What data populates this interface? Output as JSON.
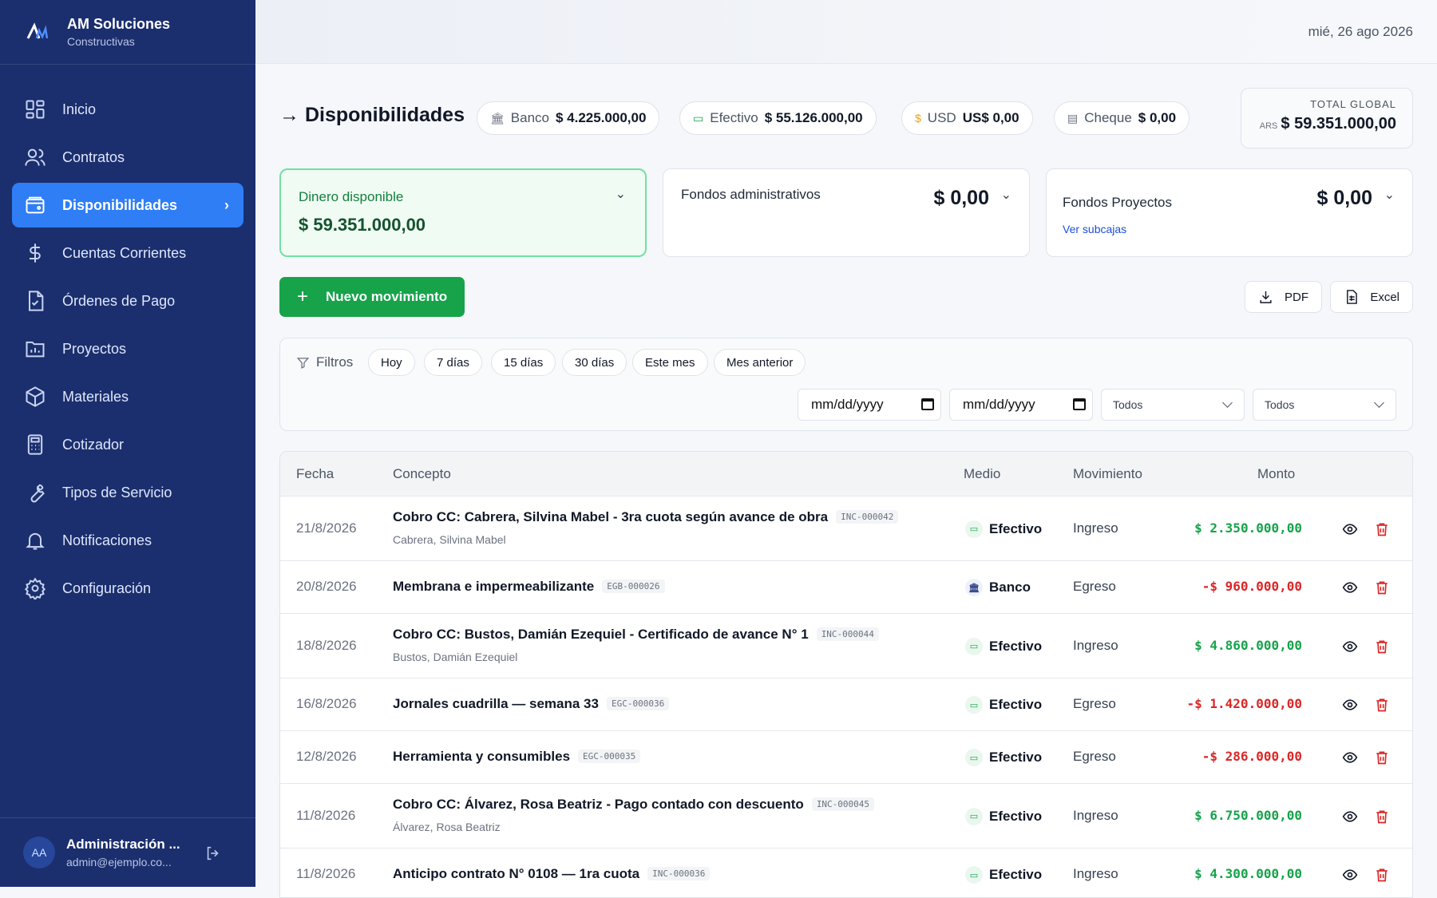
{
  "brand": {
    "name": "AM Soluciones",
    "sub": "Constructivas",
    "logo": "AM"
  },
  "topbar": {
    "date": "mié, 26 ago 2026"
  },
  "sidebar": {
    "items": [
      {
        "label": "Inicio",
        "icon": "grid-icon"
      },
      {
        "label": "Contratos",
        "icon": "users-icon"
      },
      {
        "label": "Disponibilidades",
        "icon": "wallet-icon",
        "active": true
      },
      {
        "label": "Cuentas Corrientes",
        "icon": "dollar-icon"
      },
      {
        "label": "Órdenes de Pago",
        "icon": "file-check-icon"
      },
      {
        "label": "Proyectos",
        "icon": "folder-chart-icon"
      },
      {
        "label": "Materiales",
        "icon": "box-icon"
      },
      {
        "label": "Cotizador",
        "icon": "calculator-icon"
      },
      {
        "label": "Tipos de Servicio",
        "icon": "wrench-icon"
      },
      {
        "label": "Notificaciones",
        "icon": "bell-icon"
      },
      {
        "label": "Configuración",
        "icon": "gear-icon"
      }
    ]
  },
  "user": {
    "initials": "AA",
    "name": "Administración ...",
    "email": "admin@ejemplo.co..."
  },
  "header": {
    "title": "→ Disponibilidades",
    "chips": [
      {
        "label": "Banco",
        "value": "$ 4.225.000,00",
        "icon": "bank-icon"
      },
      {
        "label": "Efectivo",
        "value": "$ 55.126.000,00",
        "icon": "cash-icon"
      },
      {
        "label": "USD",
        "value": "US$ 0,00",
        "icon": "dollar-icon"
      },
      {
        "label": "Cheque",
        "value": "$ 0,00",
        "icon": "document-icon"
      }
    ],
    "total_label": "TOTAL GLOBAL",
    "total_currency": "ARS",
    "total_value": "$ 59.351.000,00"
  },
  "cards": {
    "disponible": {
      "title": "Dinero disponible",
      "value": "$ 59.351.000,00"
    },
    "administrativos": {
      "title": "Fondos administrativos",
      "value": "$ 0,00"
    },
    "proyectos": {
      "title": "Fondos Proyectos",
      "value": "$ 0,00",
      "link": "Ver subcajas"
    }
  },
  "actions": {
    "new_label": "Nuevo movimiento",
    "pdf_label": "PDF",
    "excel_label": "Excel"
  },
  "filters": {
    "label": "Filtros",
    "pills": [
      "Hoy",
      "7 días",
      "15 días",
      "30 días",
      "Este mes",
      "Mes anterior"
    ],
    "date_from_placeholder": "mm/dd/yyyy",
    "date_to_placeholder": "mm/dd/yyyy",
    "select1": "Todos",
    "select2": "Todos"
  },
  "table": {
    "headers": {
      "fecha": "Fecha",
      "concepto": "Concepto",
      "medio": "Medio",
      "movimiento": "Movimiento",
      "monto": "Monto"
    },
    "rows": [
      {
        "fecha": "21/8/2026",
        "concepto": "Cobro CC: Cabrera, Silvina Mabel - 3ra cuota según avance de obra",
        "code": "INC-000042",
        "sub": "Cabrera, Silvina Mabel",
        "medio": "Efectivo",
        "mov": "Ingreso",
        "monto": "$ 2.350.000,00"
      },
      {
        "fecha": "20/8/2026",
        "concepto": "Membrana e impermeabilizante",
        "code": "EGB-000026",
        "sub": "",
        "medio": "Banco",
        "mov": "Egreso",
        "monto": "-$ 960.000,00"
      },
      {
        "fecha": "18/8/2026",
        "concepto": "Cobro CC: Bustos, Damián Ezequiel - Certificado de avance N° 1",
        "code": "INC-000044",
        "sub": "Bustos, Damián Ezequiel",
        "medio": "Efectivo",
        "mov": "Ingreso",
        "monto": "$ 4.860.000,00"
      },
      {
        "fecha": "16/8/2026",
        "concepto": "Jornales cuadrilla — semana 33",
        "code": "EGC-000036",
        "sub": "",
        "medio": "Efectivo",
        "mov": "Egreso",
        "monto": "-$ 1.420.000,00"
      },
      {
        "fecha": "12/8/2026",
        "concepto": "Herramienta y consumibles",
        "code": "EGC-000035",
        "sub": "",
        "medio": "Efectivo",
        "mov": "Egreso",
        "monto": "-$ 286.000,00"
      },
      {
        "fecha": "11/8/2026",
        "concepto": "Cobro CC: Álvarez, Rosa Beatriz - Pago contado con descuento",
        "code": "INC-000045",
        "sub": "Álvarez, Rosa Beatriz",
        "medio": "Efectivo",
        "mov": "Ingreso",
        "monto": "$ 6.750.000,00"
      },
      {
        "fecha": "11/8/2026",
        "concepto": "Anticipo contrato N° 0108 — 1ra cuota",
        "code": "INC-000036",
        "sub": "",
        "medio": "Efectivo",
        "mov": "Ingreso",
        "monto": "$ 4.300.000,00"
      }
    ]
  }
}
